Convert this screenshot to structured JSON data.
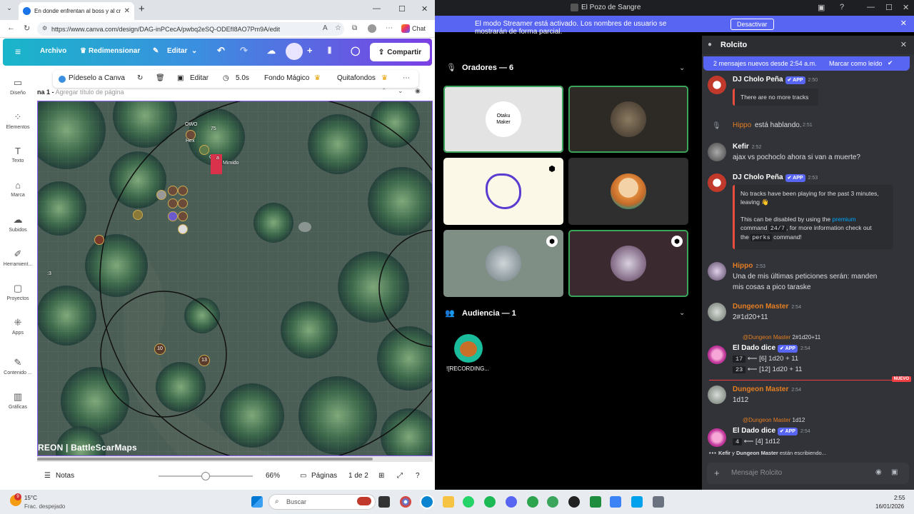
{
  "browser": {
    "tab_title": "En donde enfrentan al boss y al cr",
    "url": "https://www.canva.com/design/DAG-inPCecA/pwbq2eSQ-ODEfI8AO7Pm9A/edit",
    "chat_label": "Chat"
  },
  "canva": {
    "menu": [
      "Archivo",
      "Redimensionar",
      "Editar"
    ],
    "share_label": "Compartir",
    "rail": [
      "Diseño",
      "Elementos",
      "Texto",
      "Marca",
      "Subidos",
      "Herramient...",
      "Proyectos",
      "Apps",
      "Contenido ...",
      "Gráficas"
    ],
    "toolbar": {
      "pideselo": "Pídeselo a Canva",
      "editar": "Editar",
      "duration": "5.0s",
      "fondo": "Fondo Mágico",
      "quitafondos": "Quitafondos"
    },
    "page_label": "na 1 -",
    "page_title_placeholder": "Agregar título de página",
    "map": {
      "watermark": "REON | BattleScarMaps",
      "labels": [
        "OWO",
        "Hex",
        "75",
        "G",
        "a",
        "Mimido",
        ":3"
      ],
      "tokens_numbered": [
        "10",
        "13"
      ]
    },
    "bottom": {
      "notes": "Notas",
      "zoom": "66%",
      "pages_label": "Páginas",
      "page_count": "1 de 2",
      "zoom_fraction": 0.5
    }
  },
  "discord": {
    "window_title": "El Pozo de Sangre",
    "streamer_msg": "El modo Streamer está activado. Los nombres de usuario se mostrarán de forma parcial.",
    "streamer_btn": "Desactivar",
    "speakers_header": "Oradores — 6",
    "audience_header": "Audiencia — 1",
    "audience_name": "![RECORDING...",
    "tile1_text": "Otaku\nMaker",
    "chat": {
      "channel": "Rolcito",
      "new_messages": "2 mensajes nuevos desde 2:54 a.m.",
      "mark_read": "Marcar como leído",
      "messages": [
        {
          "name": "DJ Cholo Peña",
          "app": "APP",
          "time": "2:50",
          "embed": "There are no more tracks"
        },
        {
          "system": "Hippo",
          "system_text": "está hablando.",
          "time": "2:51"
        },
        {
          "name": "Kefir",
          "time": "2:52",
          "text": "ajax vs pochoclo ahora si van a muerte?"
        },
        {
          "name": "DJ Cholo Peña",
          "app": "APP",
          "time": "2:53",
          "embed1": "No tracks have been playing for the past 3 minutes, leaving 👋",
          "embed2a": "This can be disabled by using the",
          "embed2b": "premium",
          "embed3a": "command",
          "embed3b": "24/7",
          "embed3c": ", for more information check out",
          "embed4a": "the",
          "embed4b": "perks",
          "embed4c": "command!"
        },
        {
          "name": "Hippo",
          "time": "2:53",
          "text1": "Una de mis últimas peticiones serán: manden",
          "text2": "mis cosas a pico taraske"
        },
        {
          "name": "Dungeon Master",
          "time": "2:54",
          "text": "2#1d20+11"
        },
        {
          "reply_user": "@Dungeon Master",
          "reply_text": "2#1d20+11",
          "name": "El Dado dice",
          "app": "APP",
          "time": "2:54",
          "roll1_val": "17",
          "roll1_text": "⟵ [6] 1d20 + 11",
          "roll2_val": "23",
          "roll2_text": "⟵ [12] 1d20 + 11"
        },
        {
          "name": "Dungeon Master",
          "time": "2:54",
          "text": "1d12"
        },
        {
          "reply_user": "@Dungeon Master",
          "reply_text": "1d12",
          "name": "El Dado dice",
          "app": "APP",
          "time": "2:54",
          "roll1_val": "4",
          "roll1_text": "⟵ [4] 1d12"
        }
      ],
      "new_badge": "NUEVO",
      "typing_a": "Kefir",
      "typing_mid": "y",
      "typing_b": "Dungeon Master",
      "typing_end": "están escribiendo...",
      "input_placeholder": "Mensaje Rolcito"
    }
  },
  "taskbar": {
    "weather_temp": "15°C",
    "weather_desc": "Frac. despejado",
    "search_placeholder": "Buscar",
    "time": "2:55",
    "date": "16/01/2026",
    "weather_badge": "9"
  },
  "colors": {
    "discord_accent": "#5865f2",
    "speaking_green": "#3ba55c",
    "dm_orange": "#e67e22",
    "streamer_red": "#f23f43"
  }
}
